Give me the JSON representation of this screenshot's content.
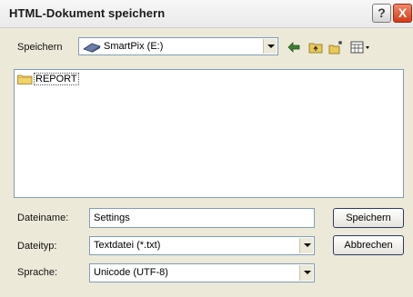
{
  "window": {
    "title": "HTML-Dokument speichern",
    "help_label": "?",
    "close_label": "X"
  },
  "toolbar": {
    "look_in_label": "Speichern",
    "location_value": "SmartPix (E:)",
    "icons": [
      "back-arrow-icon",
      "up-folder-icon",
      "new-folder-icon",
      "view-menu-icon"
    ]
  },
  "files": [
    {
      "name": "REPORT",
      "type": "folder"
    }
  ],
  "form": {
    "filename_label": "Dateiname:",
    "filename_value": "Settings",
    "filetype_label": "Dateityp:",
    "filetype_value": "Textdatei (*.txt)",
    "encoding_label": "Sprache:",
    "encoding_value": "Unicode (UTF-8)"
  },
  "buttons": {
    "save_label": "Speichern",
    "cancel_label": "Abbrechen"
  },
  "colors": {
    "dialog_bg": "#ece9d8",
    "field_border": "#7f9db9",
    "close_red": "#d23a16"
  }
}
